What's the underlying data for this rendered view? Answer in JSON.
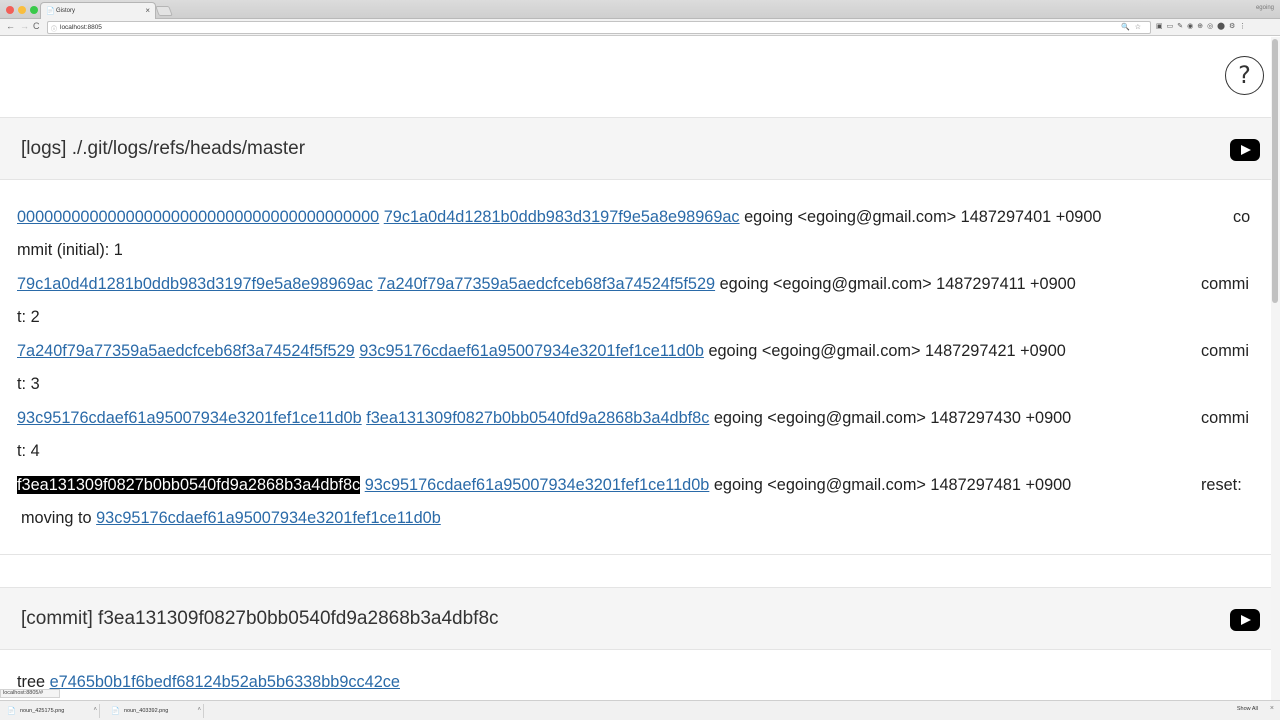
{
  "browser": {
    "tab_title": "Gistory",
    "tab_favicon": "📄",
    "tab_close": "×",
    "profile": "egoing",
    "url": "localhost:8805",
    "back_glyph": "←",
    "forward_glyph": "→",
    "reload_glyph": "C",
    "omni_info_glyph": "ⓘ",
    "omni_tools_glyphs": "🔍☆",
    "extension_glyphs": "▣▭✎◉⊕◎⬤⚙⋮"
  },
  "help": {
    "label": "?"
  },
  "logs_panel": {
    "title": "[logs] ./.git/logs/refs/heads/master",
    "video_icon": "youtube-play-icon",
    "entries": [
      {
        "old": "0000000000000000000000000000000000000000",
        "new": "79c1a0d4d1281b0ddb983d3197f9e5a8e98969ac",
        "info": "egoing <egoing@gmail.com> 1487297401 +0900",
        "msg1": "co",
        "msg2": "mmit (initial): 1"
      },
      {
        "old": "79c1a0d4d1281b0ddb983d3197f9e5a8e98969ac",
        "new": "7a240f79a77359a5aedcfceb68f3a74524f5f529",
        "info": "egoing <egoing@gmail.com> 1487297411 +0900",
        "msg1": "commi",
        "msg2": "t: 2"
      },
      {
        "old": "7a240f79a77359a5aedcfceb68f3a74524f5f529",
        "new": "93c95176cdaef61a95007934e3201fef1ce11d0b",
        "info": "egoing <egoing@gmail.com> 1487297421 +0900",
        "msg1": "commi",
        "msg2": "t: 3"
      },
      {
        "old": "93c95176cdaef61a95007934e3201fef1ce11d0b",
        "new": "f3ea131309f0827b0bb0540fd9a2868b3a4dbf8c",
        "info": "egoing <egoing@gmail.com> 1487297430 +0900",
        "msg1": "commi",
        "msg2": "t: 4"
      },
      {
        "old": "f3ea131309f0827b0bb0540fd9a2868b3a4dbf8c",
        "new": "93c95176cdaef61a95007934e3201fef1ce11d0b",
        "info": "egoing <egoing@gmail.com> 1487297481 +0900",
        "msg1": "reset:",
        "msg2": "moving to",
        "msg2_link": "93c95176cdaef61a95007934e3201fef1ce11d0b"
      }
    ]
  },
  "commit_panel": {
    "title": "[commit] f3ea131309f0827b0bb0540fd9a2868b3a4dbf8c",
    "tree_label": "tree",
    "tree_hash": "e7465b0b1f6bedf68124b52ab5b6338bb9cc42ce"
  },
  "status": {
    "text": "localhost:8805/#"
  },
  "downloads": {
    "items": [
      "noun_425175.png",
      "noun_403392.png"
    ],
    "file_icon": "📄",
    "caret": "˄",
    "show_all": "Show All",
    "close": "×"
  }
}
